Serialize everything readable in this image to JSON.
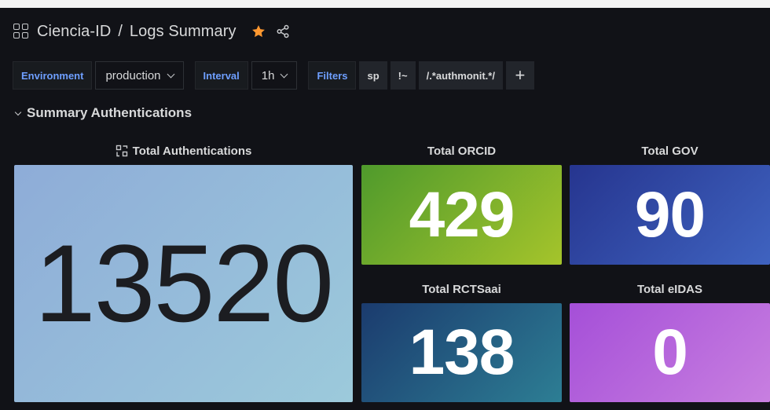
{
  "header": {
    "folder": "Ciencia-ID",
    "separator": "/",
    "title": "Logs Summary"
  },
  "variables": {
    "environment": {
      "label": "Environment",
      "value": "production"
    },
    "interval": {
      "label": "Interval",
      "value": "1h"
    },
    "filters": {
      "label": "Filters",
      "key": "sp",
      "operator": "!~",
      "value": "/.*authmonit.*/",
      "add": "+"
    }
  },
  "row": {
    "title": "Summary Authentications"
  },
  "panels": [
    {
      "title": "Total Authentications",
      "value": "13520",
      "gradient": [
        "#8eacd8",
        "#9ccadb"
      ]
    },
    {
      "title": "Total ORCID",
      "value": "429",
      "gradient": [
        "#4f9a2c",
        "#a5c42b"
      ]
    },
    {
      "title": "Total GOV",
      "value": "90",
      "gradient": [
        "#26358f",
        "#3f63c0"
      ]
    },
    {
      "title": "Total RCTSaai",
      "value": "138",
      "gradient": [
        "#1b3b6e",
        "#2d7e94"
      ]
    },
    {
      "title": "Total eIDAS",
      "value": "0",
      "gradient": [
        "#a54fd8",
        "#c87fe0"
      ]
    }
  ],
  "colors": {
    "star": "#ff9830",
    "link": "#6e9fff",
    "background": "#111217"
  }
}
